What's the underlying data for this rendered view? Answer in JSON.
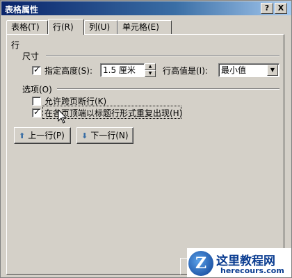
{
  "window": {
    "title": "表格属性",
    "help_glyph": "?",
    "close_glyph": "X"
  },
  "tabs": [
    {
      "label": "表格(T)",
      "active": false
    },
    {
      "label": "行(R)",
      "active": true
    },
    {
      "label": "列(U)",
      "active": false
    },
    {
      "label": "单元格(E)",
      "active": false
    }
  ],
  "row_tab": {
    "section_title": "行",
    "size_group": "尺寸",
    "specify_height_label": "指定高度(S):",
    "specify_height_checked": true,
    "height_value": "1.5 厘米",
    "row_height_is_label": "行高值是(I):",
    "row_height_mode": "最小值",
    "options_group": "选项(O)",
    "allow_break_label": "允许跨页断行(K)",
    "allow_break_checked": false,
    "repeat_header_label": "在各页顶端以标题行形式重复出现(H)",
    "repeat_header_checked": true,
    "prev_row_label": "上一行(P)",
    "next_row_label": "下一行(N)"
  },
  "watermark": {
    "logo_letter": "Z",
    "name": "这里教程网",
    "domain": "herecours.com"
  },
  "colors": {
    "title_bar": "#0a246a",
    "dialog_bg": "#d4d0c8",
    "button_arrow": "#3a6ea5"
  }
}
